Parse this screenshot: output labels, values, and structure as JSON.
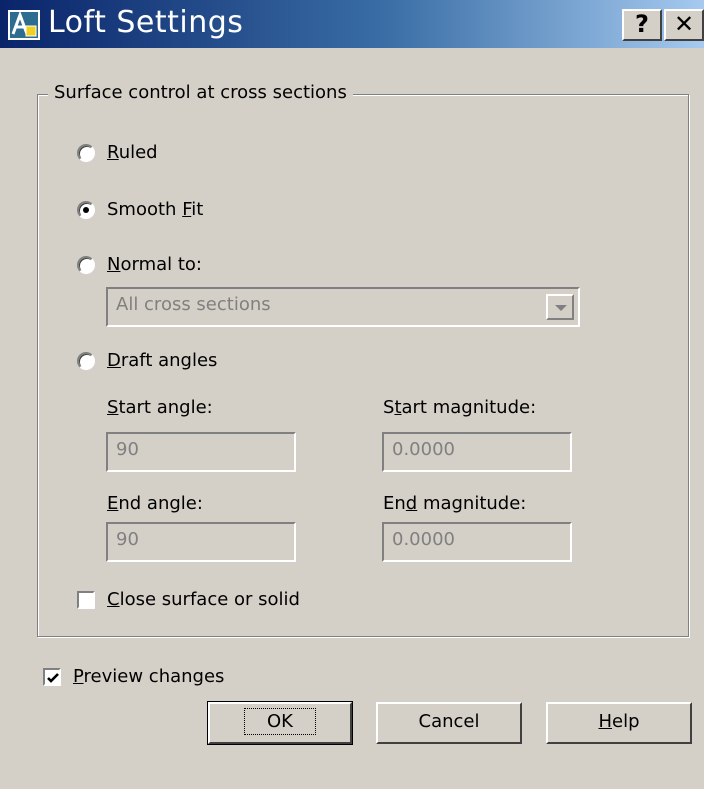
{
  "window": {
    "title": "Loft Settings",
    "help_button": "?",
    "close_button": "✕"
  },
  "group": {
    "title": "Surface control at cross sections"
  },
  "options": {
    "ruled": {
      "mnemonic": "R",
      "rest": "uled",
      "selected": false
    },
    "smooth_fit": {
      "pre": "Smooth ",
      "mnemonic": "F",
      "rest": "it",
      "selected": true
    },
    "normal_to": {
      "mnemonic": "N",
      "rest": "ormal to:",
      "selected": false
    },
    "normal_to_dropdown": {
      "value": "All cross sections"
    },
    "draft_angles": {
      "mnemonic": "D",
      "rest": "raft angles",
      "selected": false
    }
  },
  "draft": {
    "start_angle_label": {
      "mnemonic": "S",
      "rest": "tart angle:"
    },
    "start_angle_value": "90",
    "start_magnitude_label": {
      "pre": "S",
      "mnemonic": "t",
      "rest": "art magnitude:"
    },
    "start_magnitude_value": "0.0000",
    "end_angle_label": {
      "mnemonic": "E",
      "rest": "nd angle:"
    },
    "end_angle_value": "90",
    "end_magnitude_label": {
      "pre": "En",
      "mnemonic": "d",
      "rest": " magnitude:"
    },
    "end_magnitude_value": "0.0000"
  },
  "close_surface": {
    "mnemonic": "C",
    "rest": "lose surface or solid",
    "checked": false
  },
  "preview": {
    "mnemonic": "P",
    "rest": "review changes",
    "checked": true
  },
  "buttons": {
    "ok": "OK",
    "cancel": "Cancel",
    "help": {
      "mnemonic": "H",
      "rest": "elp"
    }
  },
  "colors": {
    "face": "#d4d0c8",
    "title_start": "#0a246a",
    "title_end": "#a6caf0",
    "disabled_text": "#808080"
  }
}
